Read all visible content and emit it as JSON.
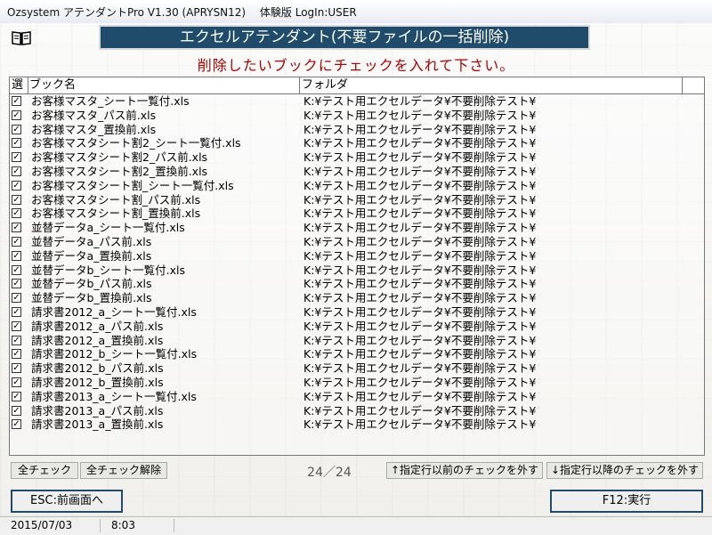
{
  "window": {
    "title": "Ozsystem アテンダントPro V1.30 (APRYSN12)　 体験版 LogIn:USER"
  },
  "header": {
    "banner": "エクセルアテンダント(不要ファイルの一括削除)",
    "instruction": "削除したいブックにチェックを入れて下さい。"
  },
  "grid": {
    "columns": {
      "select": "選",
      "book": "ブック名",
      "folder": "フォルダ"
    },
    "rows": [
      {
        "checked": true,
        "book": "お客様マスタ_シート一覧付.xls",
        "folder": "K:¥テスト用エクセルデータ¥不要削除テスト¥"
      },
      {
        "checked": true,
        "book": "お客様マスタ_パス前.xls",
        "folder": "K:¥テスト用エクセルデータ¥不要削除テスト¥"
      },
      {
        "checked": true,
        "book": "お客様マスタ_置換前.xls",
        "folder": "K:¥テスト用エクセルデータ¥不要削除テスト¥"
      },
      {
        "checked": true,
        "book": "お客様マスタシート割2_シート一覧付.xls",
        "folder": "K:¥テスト用エクセルデータ¥不要削除テスト¥"
      },
      {
        "checked": true,
        "book": "お客様マスタシート割2_パス前.xls",
        "folder": "K:¥テスト用エクセルデータ¥不要削除テスト¥"
      },
      {
        "checked": true,
        "book": "お客様マスタシート割2_置換前.xls",
        "folder": "K:¥テスト用エクセルデータ¥不要削除テスト¥"
      },
      {
        "checked": true,
        "book": "お客様マスタシート割_シート一覧付.xls",
        "folder": "K:¥テスト用エクセルデータ¥不要削除テスト¥"
      },
      {
        "checked": true,
        "book": "お客様マスタシート割_パス前.xls",
        "folder": "K:¥テスト用エクセルデータ¥不要削除テスト¥"
      },
      {
        "checked": true,
        "book": "お客様マスタシート割_置換前.xls",
        "folder": "K:¥テスト用エクセルデータ¥不要削除テスト¥"
      },
      {
        "checked": true,
        "book": "並替データa_シート一覧付.xls",
        "folder": "K:¥テスト用エクセルデータ¥不要削除テスト¥"
      },
      {
        "checked": true,
        "book": "並替データa_パス前.xls",
        "folder": "K:¥テスト用エクセルデータ¥不要削除テスト¥"
      },
      {
        "checked": true,
        "book": "並替データa_置換前.xls",
        "folder": "K:¥テスト用エクセルデータ¥不要削除テスト¥"
      },
      {
        "checked": true,
        "book": "並替データb_シート一覧付.xls",
        "folder": "K:¥テスト用エクセルデータ¥不要削除テスト¥"
      },
      {
        "checked": true,
        "book": "並替データb_パス前.xls",
        "folder": "K:¥テスト用エクセルデータ¥不要削除テスト¥"
      },
      {
        "checked": true,
        "book": "並替データb_置換前.xls",
        "folder": "K:¥テスト用エクセルデータ¥不要削除テスト¥"
      },
      {
        "checked": true,
        "book": "請求書2012_a_シート一覧付.xls",
        "folder": "K:¥テスト用エクセルデータ¥不要削除テスト¥"
      },
      {
        "checked": true,
        "book": "請求書2012_a_パス前.xls",
        "folder": "K:¥テスト用エクセルデータ¥不要削除テスト¥"
      },
      {
        "checked": true,
        "book": "請求書2012_a_置換前.xls",
        "folder": "K:¥テスト用エクセルデータ¥不要削除テスト¥"
      },
      {
        "checked": true,
        "book": "請求書2012_b_シート一覧付.xls",
        "folder": "K:¥テスト用エクセルデータ¥不要削除テスト¥"
      },
      {
        "checked": true,
        "book": "請求書2012_b_パス前.xls",
        "folder": "K:¥テスト用エクセルデータ¥不要削除テスト¥"
      },
      {
        "checked": true,
        "book": "請求書2012_b_置換前.xls",
        "folder": "K:¥テスト用エクセルデータ¥不要削除テスト¥"
      },
      {
        "checked": true,
        "book": "請求書2013_a_シート一覧付.xls",
        "folder": "K:¥テスト用エクセルデータ¥不要削除テスト¥"
      },
      {
        "checked": true,
        "book": "請求書2013_a_パス前.xls",
        "folder": "K:¥テスト用エクセルデータ¥不要削除テスト¥"
      },
      {
        "checked": true,
        "book": "請求書2013_a_置換前.xls",
        "folder": "K:¥テスト用エクセルデータ¥不要削除テスト¥"
      }
    ]
  },
  "actions": {
    "check_all": "全チェック",
    "uncheck_all": "全チェック解除",
    "counter": "24／24",
    "uncheck_before": "↑指定行以前のチェックを外す",
    "uncheck_after": "↓指定行以降のチェックを外す",
    "back": "ESC:前画面へ",
    "execute": "F12:実行"
  },
  "status": {
    "date": "2015/07/03",
    "time": "8:03"
  },
  "colors": {
    "banner": "#1f4c6b",
    "instruction": "#b00000"
  },
  "icons": {
    "app": "book-icon"
  }
}
